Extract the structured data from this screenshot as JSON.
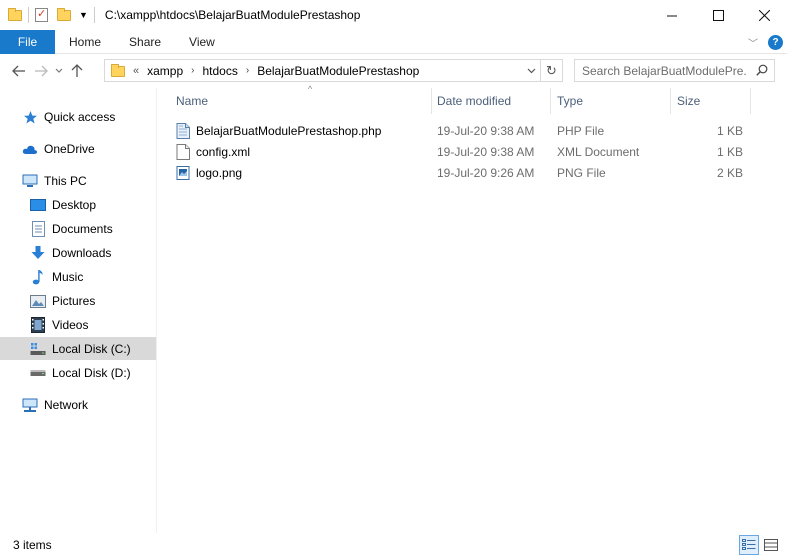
{
  "window": {
    "title": "C:\\xampp\\htdocs\\BelajarBuatModulePrestashop",
    "controls": {
      "minimize": "—",
      "maximize": "☐",
      "close": "✕"
    }
  },
  "ribbon": {
    "file_tab": "File",
    "tabs": [
      "Home",
      "Share",
      "View"
    ],
    "help": "?"
  },
  "address": {
    "overflow": "«",
    "crumbs": [
      "xampp",
      "htdocs",
      "BelajarBuatModulePrestashop"
    ],
    "refresh": "↻"
  },
  "search": {
    "placeholder": "Search BelajarBuatModulePre..."
  },
  "sidebar": {
    "items": [
      {
        "label": "Quick access",
        "icon": "star-icon"
      },
      {
        "label": "OneDrive",
        "icon": "cloud-icon"
      },
      {
        "label": "This PC",
        "icon": "computer-icon"
      },
      {
        "label": "Desktop",
        "icon": "desktop-icon"
      },
      {
        "label": "Documents",
        "icon": "documents-icon"
      },
      {
        "label": "Downloads",
        "icon": "download-icon"
      },
      {
        "label": "Music",
        "icon": "music-icon"
      },
      {
        "label": "Pictures",
        "icon": "pictures-icon"
      },
      {
        "label": "Videos",
        "icon": "videos-icon"
      },
      {
        "label": "Local Disk (C:)",
        "icon": "drive-c-icon"
      },
      {
        "label": "Local Disk (D:)",
        "icon": "drive-icon"
      },
      {
        "label": "Network",
        "icon": "network-icon"
      }
    ]
  },
  "columns": [
    "Name",
    "Date modified",
    "Type",
    "Size"
  ],
  "files": [
    {
      "name": "BelajarBuatModulePrestashop.php",
      "date": "19-Jul-20 9:38 AM",
      "type": "PHP File",
      "size": "1 KB",
      "icon": "php-file-icon"
    },
    {
      "name": "config.xml",
      "date": "19-Jul-20 9:38 AM",
      "type": "XML Document",
      "size": "1 KB",
      "icon": "xml-file-icon"
    },
    {
      "name": "logo.png",
      "date": "19-Jul-20 9:26 AM",
      "type": "PNG File",
      "size": "2 KB",
      "icon": "png-file-icon"
    }
  ],
  "status": {
    "items_count": "3 items"
  },
  "colors": {
    "accent": "#1979ca",
    "selected_nav": "#d9d9d9"
  }
}
